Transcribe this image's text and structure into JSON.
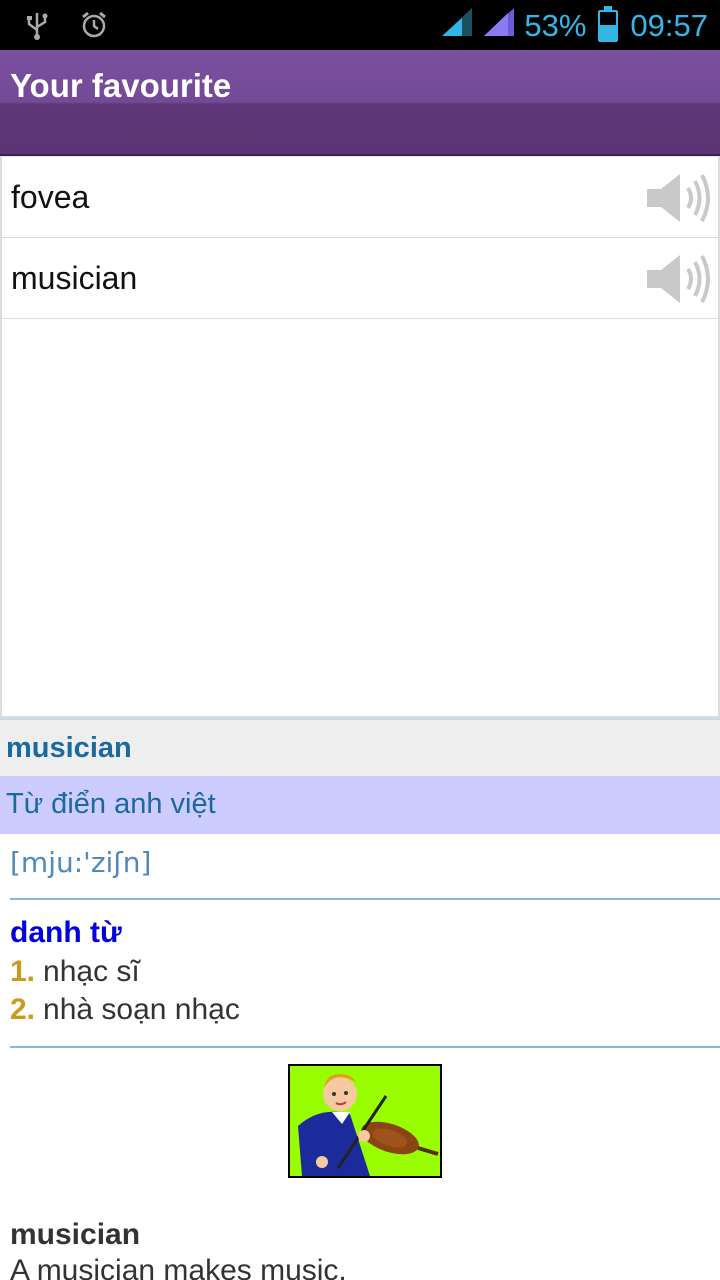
{
  "status_bar": {
    "icons_left": [
      "usb-icon",
      "alarm-clock-icon"
    ],
    "icons_right": [
      "signal-icon",
      "signal-icon",
      "battery-charging-icon"
    ],
    "battery_percent": "53%",
    "time": "09:57",
    "accent_color": "#33b5e5"
  },
  "title_bar": {
    "title": "Your favourite",
    "color": "#734a98"
  },
  "favourites": [
    {
      "word": "fovea",
      "icon": "speaker-icon"
    },
    {
      "word": "musician",
      "icon": "speaker-icon"
    }
  ],
  "definition": {
    "word": "musician",
    "dictionary": "Từ điển anh việt",
    "phonetic": "[mju:'ziʃn]",
    "part_of_speech": "danh từ",
    "meanings": [
      {
        "num": "1.",
        "text": "nhạc sĩ"
      },
      {
        "num": "2.",
        "text": "nhà soạn nhạc"
      }
    ],
    "picture_icon": "violinist-picture",
    "example_word": "musician",
    "example_text": "A musician makes music."
  }
}
